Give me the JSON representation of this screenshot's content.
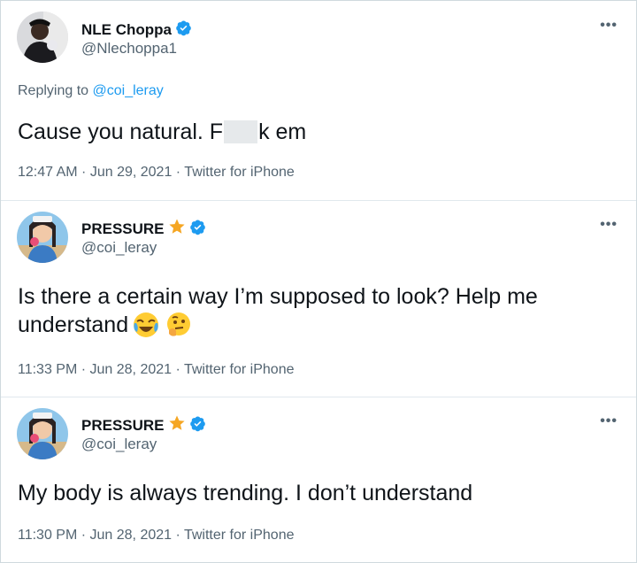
{
  "tweets": [
    {
      "name": "NLE Choppa",
      "handle": "@Nlechoppa1",
      "verified": true,
      "star": false,
      "replying_label": "Replying to",
      "replying_to": "@coi_leray",
      "text_before": "Cause you natural. F",
      "text_after": "k em",
      "time": "12:47 AM",
      "date": "Jun 29, 2021",
      "source": "Twitter for iPhone",
      "more": "•••"
    },
    {
      "name": "PRESSURE",
      "handle": "@coi_leray",
      "verified": true,
      "star": true,
      "text_line1": "Is there a certain way I’m supposed to look? Help me",
      "text_line2": "understand",
      "emojis": [
        "face-with-tears-of-joy-emoji",
        "thinking-face-emoji"
      ],
      "time": "11:33 PM",
      "date": "Jun 28, 2021",
      "source": "Twitter for iPhone",
      "more": "•••"
    },
    {
      "name": "PRESSURE",
      "handle": "@coi_leray",
      "verified": true,
      "star": true,
      "text": "My body is always trending. I don’t understand",
      "time": "11:30 PM",
      "date": "Jun 28, 2021",
      "source": "Twitter for iPhone",
      "more": "•••"
    }
  ],
  "separator": " · ",
  "colors": {
    "verified": "#1d9bf0",
    "star": "#f5a623",
    "secondary_text": "#536471",
    "link": "#1d9bf0"
  }
}
